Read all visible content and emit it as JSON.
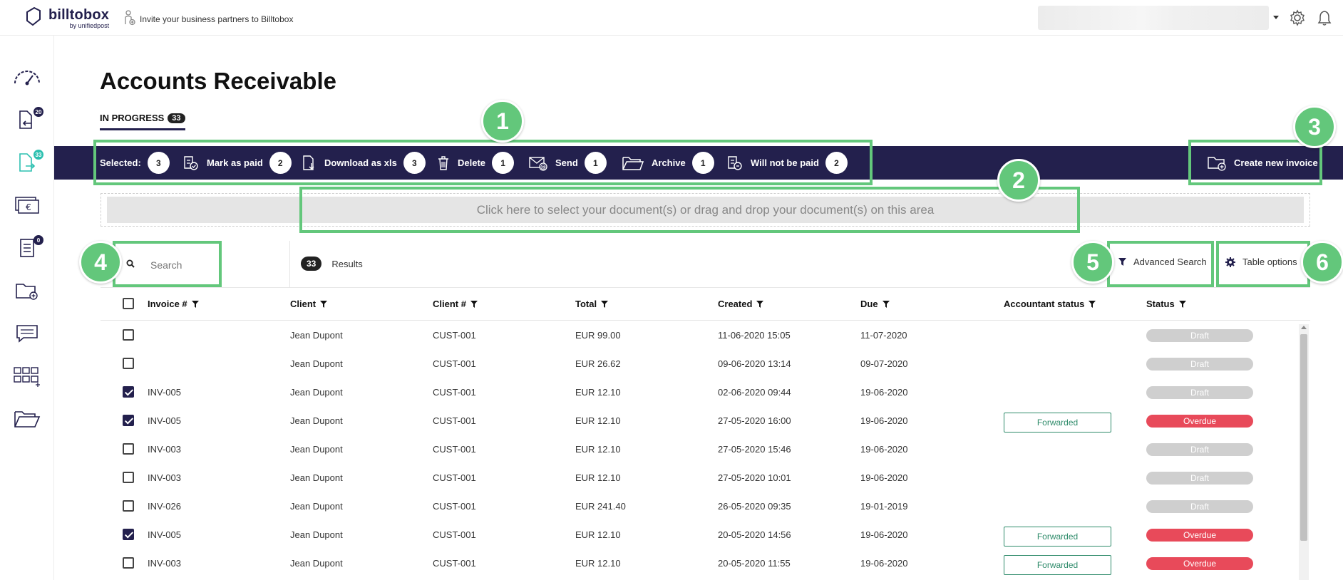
{
  "app": {
    "logo_main": "billtobox",
    "logo_sub": "by unifiedpost",
    "invite_text": "Invite your business partners to Billtobox"
  },
  "sidebar": {
    "items": [
      {
        "icon": "dashboard-gauge-icon",
        "badge": ""
      },
      {
        "icon": "incoming-documents-icon",
        "badge": "20"
      },
      {
        "icon": "outgoing-documents-icon",
        "badge": "33"
      },
      {
        "icon": "euro-payments-icon",
        "badge": ""
      },
      {
        "icon": "document-list-icon",
        "badge": "0"
      },
      {
        "icon": "folder-add-icon",
        "badge": ""
      },
      {
        "icon": "messages-icon",
        "badge": ""
      },
      {
        "icon": "apps-grid-icon",
        "badge": ""
      },
      {
        "icon": "open-folder-icon",
        "badge": ""
      }
    ]
  },
  "page": {
    "title": "Accounts Receivable",
    "tab_label": "IN PROGRESS",
    "tab_count": "33"
  },
  "actions": {
    "selected_label": "Selected:",
    "selected_count": "3",
    "mark_paid": {
      "label": "Mark as paid",
      "count": "2"
    },
    "download_xls": {
      "label": "Download as xls",
      "count": "3"
    },
    "delete": {
      "label": "Delete",
      "count": "1"
    },
    "send": {
      "label": "Send",
      "count": "1"
    },
    "archive": {
      "label": "Archive",
      "count": "1"
    },
    "will_not_be_paid": {
      "label": "Will not be paid",
      "count": "2"
    },
    "create_new": "Create new invoice"
  },
  "dropzone": {
    "text": "Click here to select your document(s) or drag and drop your document(s) on this area"
  },
  "toolbar": {
    "search_placeholder": "Search",
    "results_count": "33",
    "results_label": "Results",
    "advanced_search": "Advanced Search",
    "table_options": "Table options"
  },
  "table": {
    "headers": {
      "invoice": "Invoice #",
      "client": "Client",
      "client_no": "Client #",
      "total": "Total",
      "created": "Created",
      "due": "Due",
      "accountant_status": "Accountant status",
      "status": "Status"
    },
    "rows": [
      {
        "checked": false,
        "invoice": "",
        "client": "Jean Dupont",
        "client_no": "CUST-001",
        "total": "EUR 99.00",
        "created": "11-06-2020 15:05",
        "due": "11-07-2020",
        "accountant_status": "",
        "status": "Draft"
      },
      {
        "checked": false,
        "invoice": "",
        "client": "Jean Dupont",
        "client_no": "CUST-001",
        "total": "EUR 26.62",
        "created": "09-06-2020 13:14",
        "due": "09-07-2020",
        "accountant_status": "",
        "status": "Draft"
      },
      {
        "checked": true,
        "invoice": "INV-005",
        "client": "Jean Dupont",
        "client_no": "CUST-001",
        "total": "EUR 12.10",
        "created": "02-06-2020 09:44",
        "due": "19-06-2020",
        "accountant_status": "",
        "status": "Draft"
      },
      {
        "checked": true,
        "invoice": "INV-005",
        "client": "Jean Dupont",
        "client_no": "CUST-001",
        "total": "EUR 12.10",
        "created": "27-05-2020 16:00",
        "due": "19-06-2020",
        "accountant_status": "Forwarded",
        "status": "Overdue"
      },
      {
        "checked": false,
        "invoice": "INV-003",
        "client": "Jean Dupont",
        "client_no": "CUST-001",
        "total": "EUR 12.10",
        "created": "27-05-2020 15:46",
        "due": "19-06-2020",
        "accountant_status": "",
        "status": "Draft"
      },
      {
        "checked": false,
        "invoice": "INV-003",
        "client": "Jean Dupont",
        "client_no": "CUST-001",
        "total": "EUR 12.10",
        "created": "27-05-2020 10:01",
        "due": "19-06-2020",
        "accountant_status": "",
        "status": "Draft"
      },
      {
        "checked": false,
        "invoice": "INV-026",
        "client": "Jean Dupont",
        "client_no": "CUST-001",
        "total": "EUR 241.40",
        "created": "26-05-2020 09:35",
        "due": "19-01-2019",
        "accountant_status": "",
        "status": "Draft"
      },
      {
        "checked": true,
        "invoice": "INV-005",
        "client": "Jean Dupont",
        "client_no": "CUST-001",
        "total": "EUR 12.10",
        "created": "20-05-2020 14:56",
        "due": "19-06-2020",
        "accountant_status": "Forwarded",
        "status": "Overdue"
      },
      {
        "checked": false,
        "invoice": "INV-003",
        "client": "Jean Dupont",
        "client_no": "CUST-001",
        "total": "EUR 12.10",
        "created": "20-05-2020 11:55",
        "due": "19-06-2020",
        "accountant_status": "Forwarded",
        "status": "Overdue"
      }
    ]
  },
  "annotations": [
    "1",
    "2",
    "3",
    "4",
    "5",
    "6"
  ],
  "colors": {
    "brand_navy": "#23204d",
    "annotation_green": "#63c77b",
    "draft_gray": "#cfcfcf",
    "overdue_red": "#e84a5a",
    "forwarded_green": "#2e8b6a"
  }
}
